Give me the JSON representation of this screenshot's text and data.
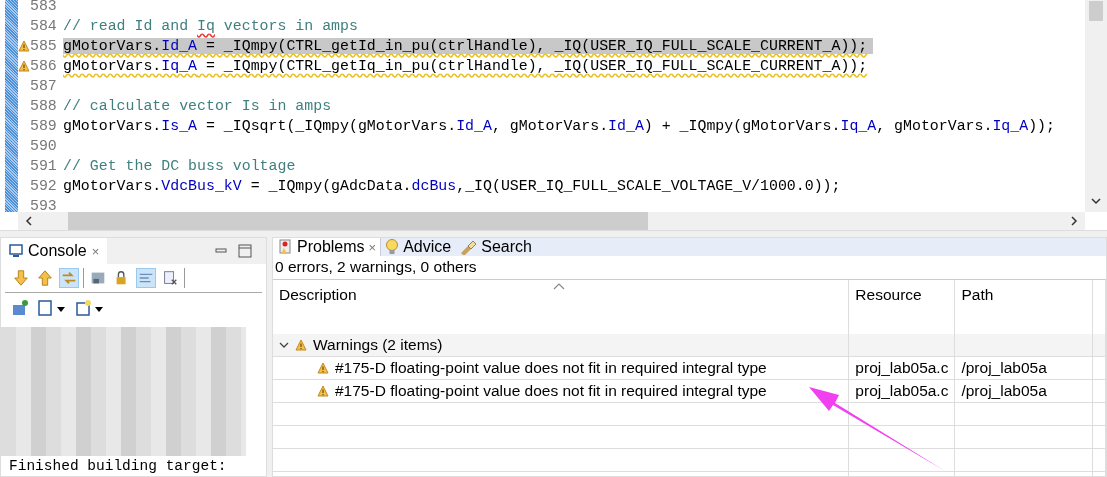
{
  "editor": {
    "lines": [
      {
        "number": "583",
        "highlighted": false,
        "warning": false
      },
      {
        "number": "584",
        "highlighted": false,
        "warning": false,
        "tokens": [
          {
            "kind": "comment",
            "text": "// read Id and "
          },
          {
            "kind": "misspelled",
            "text": "Iq"
          },
          {
            "kind": "comment",
            "text": " vectors in amps"
          }
        ]
      },
      {
        "number": "585",
        "highlighted": true,
        "warning": true,
        "tokens": [
          {
            "kind": "plain",
            "text": "gMotorVars."
          },
          {
            "kind": "field",
            "text": "Id_A"
          },
          {
            "kind": "plain",
            "text": " = _IQmpy(CTRL_getId_in_pu(ctrlHandle), _IQ(USER_IQ_FULL_SCALE_CURRENT_A));"
          }
        ]
      },
      {
        "number": "586",
        "highlighted": false,
        "warning": true,
        "tokens": [
          {
            "kind": "plain",
            "text": "gMotorVars."
          },
          {
            "kind": "field",
            "text": "Iq_A"
          },
          {
            "kind": "plain",
            "text": " = _IQmpy(CTRL_getIq_in_pu(ctrlHandle), _IQ(USER_IQ_FULL_SCALE_CURRENT_A));"
          }
        ]
      },
      {
        "number": "587",
        "highlighted": false,
        "warning": false
      },
      {
        "number": "588",
        "highlighted": false,
        "warning": false,
        "tokens": [
          {
            "kind": "comment",
            "text": "// calculate vector Is in amps"
          }
        ]
      },
      {
        "number": "589",
        "highlighted": false,
        "warning": false,
        "tokens": [
          {
            "kind": "plain",
            "text": "gMotorVars."
          },
          {
            "kind": "field",
            "text": "Is_A"
          },
          {
            "kind": "plain",
            "text": " = _IQsqrt(_IQmpy(gMotorVars."
          },
          {
            "kind": "field",
            "text": "Id_A"
          },
          {
            "kind": "plain",
            "text": ", gMotorVars."
          },
          {
            "kind": "field",
            "text": "Id_A"
          },
          {
            "kind": "plain",
            "text": ") + _IQmpy(gMotorVars."
          },
          {
            "kind": "field",
            "text": "Iq_A"
          },
          {
            "kind": "plain",
            "text": ", gMotorVars."
          },
          {
            "kind": "field",
            "text": "Iq_A"
          },
          {
            "kind": "plain",
            "text": "));"
          }
        ]
      },
      {
        "number": "590",
        "highlighted": false,
        "warning": false
      },
      {
        "number": "591",
        "highlighted": false,
        "warning": false,
        "tokens": [
          {
            "kind": "comment",
            "text": "// Get the DC buss voltage"
          }
        ]
      },
      {
        "number": "592",
        "highlighted": false,
        "warning": false,
        "tokens": [
          {
            "kind": "plain",
            "text": "gMotorVars."
          },
          {
            "kind": "field",
            "text": "VdcBus_kV"
          },
          {
            "kind": "plain",
            "text": " = _IQmpy(gAdcData."
          },
          {
            "kind": "field",
            "text": "dcBus"
          },
          {
            "kind": "plain",
            "text": ",_IQ(USER_IQ_FULL_SCALE_VOLTAGE_V/1000.0));"
          }
        ]
      },
      {
        "number": "593",
        "highlighted": false,
        "warning": false
      }
    ]
  },
  "console": {
    "tab": {
      "label": "Console",
      "close": "×"
    },
    "toolbar_buttons": [
      {
        "kind": "down",
        "selected": false
      },
      {
        "kind": "up",
        "selected": false
      },
      {
        "kind": "link",
        "selected": true
      },
      {
        "kind": "save",
        "selected": false
      },
      {
        "kind": "lock",
        "selected": false
      },
      {
        "kind": "wrap",
        "selected": true
      },
      {
        "kind": "clear",
        "selected": false
      }
    ],
    "output": [
      "Finished building target:"
    ]
  },
  "problems": {
    "tabs": [
      {
        "label": "Problems",
        "kind": "problems",
        "selected": true,
        "close": "×"
      },
      {
        "label": "Advice",
        "kind": "advice",
        "selected": false
      },
      {
        "label": "Search",
        "kind": "search",
        "selected": false
      }
    ],
    "summary": "0 errors, 2 warnings, 0 others",
    "columns": [
      "Description",
      "Resource",
      "Path"
    ],
    "groups": [
      {
        "label": "Warnings (2 items)",
        "expanded": true,
        "children": [
          {
            "description": "#175-D floating-point value does not fit in required integral type",
            "resource": "proj_lab05a.c",
            "path": "/proj_lab05a"
          },
          {
            "description": "#175-D floating-point value does not fit in required integral type",
            "resource": "proj_lab05a.c",
            "path": "/proj_lab05a"
          }
        ]
      }
    ]
  }
}
